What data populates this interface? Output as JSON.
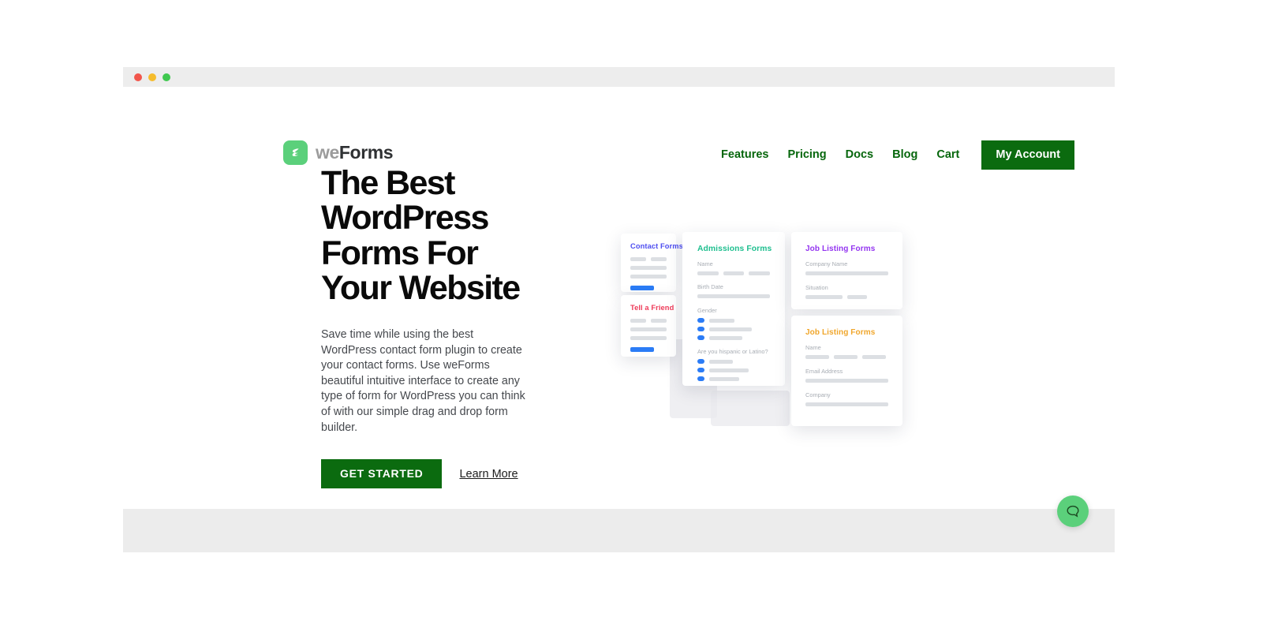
{
  "window": {
    "traffic_lights": [
      {
        "name": "close",
        "color": "#f2564c"
      },
      {
        "name": "minimize",
        "color": "#f5bc2c"
      },
      {
        "name": "maximize",
        "color": "#3fc84f"
      }
    ]
  },
  "brand": {
    "logo_icon": "weforms-mark-icon",
    "name_part1": "we",
    "name_part2": "Forms",
    "accent_green": "#5bd07b",
    "dark_green": "#0b6b0f"
  },
  "nav": {
    "links": [
      {
        "label": "Features"
      },
      {
        "label": "Pricing"
      },
      {
        "label": "Docs"
      },
      {
        "label": "Blog"
      },
      {
        "label": "Cart"
      }
    ],
    "cta": {
      "label": "My Account"
    }
  },
  "hero": {
    "title": "The Best WordPress Forms For Your Website",
    "body": "Save time while using the best WordPress contact form plugin to create your contact forms. Use weForms beautiful intuitive interface to create any type of form for WordPress you can think of with our simple drag and drop form builder.",
    "primary_button": "GET STARTED",
    "secondary_link": "Learn More"
  },
  "illustration": {
    "cards": [
      {
        "id": "contact",
        "title": "Contact Forms",
        "title_color": "#4d4df0",
        "fields": []
      },
      {
        "id": "tell-a-friend",
        "title": "Tell a Friend",
        "title_color": "#ee3a58",
        "fields": []
      },
      {
        "id": "admissions",
        "title": "Admissions Forms",
        "title_color": "#1fbf8f",
        "fields": [
          {
            "label": "Name"
          },
          {
            "label": "Birth Date"
          },
          {
            "label": "Gender"
          },
          {
            "label": "Are you hispanic or Latino?"
          }
        ]
      },
      {
        "id": "job-listing-purple",
        "title": "Job Listing Forms",
        "title_color": "#9334f0",
        "fields": [
          {
            "label": "Company Name"
          },
          {
            "label": "Situation"
          }
        ]
      },
      {
        "id": "job-listing-orange",
        "title": "Job Listing Forms",
        "title_color": "#f0a62b",
        "fields": [
          {
            "label": "Name"
          },
          {
            "label": "Email Address"
          },
          {
            "label": "Company"
          }
        ]
      }
    ]
  },
  "chat": {
    "icon": "chat-bubble-icon",
    "button_color": "#5bd07b"
  }
}
